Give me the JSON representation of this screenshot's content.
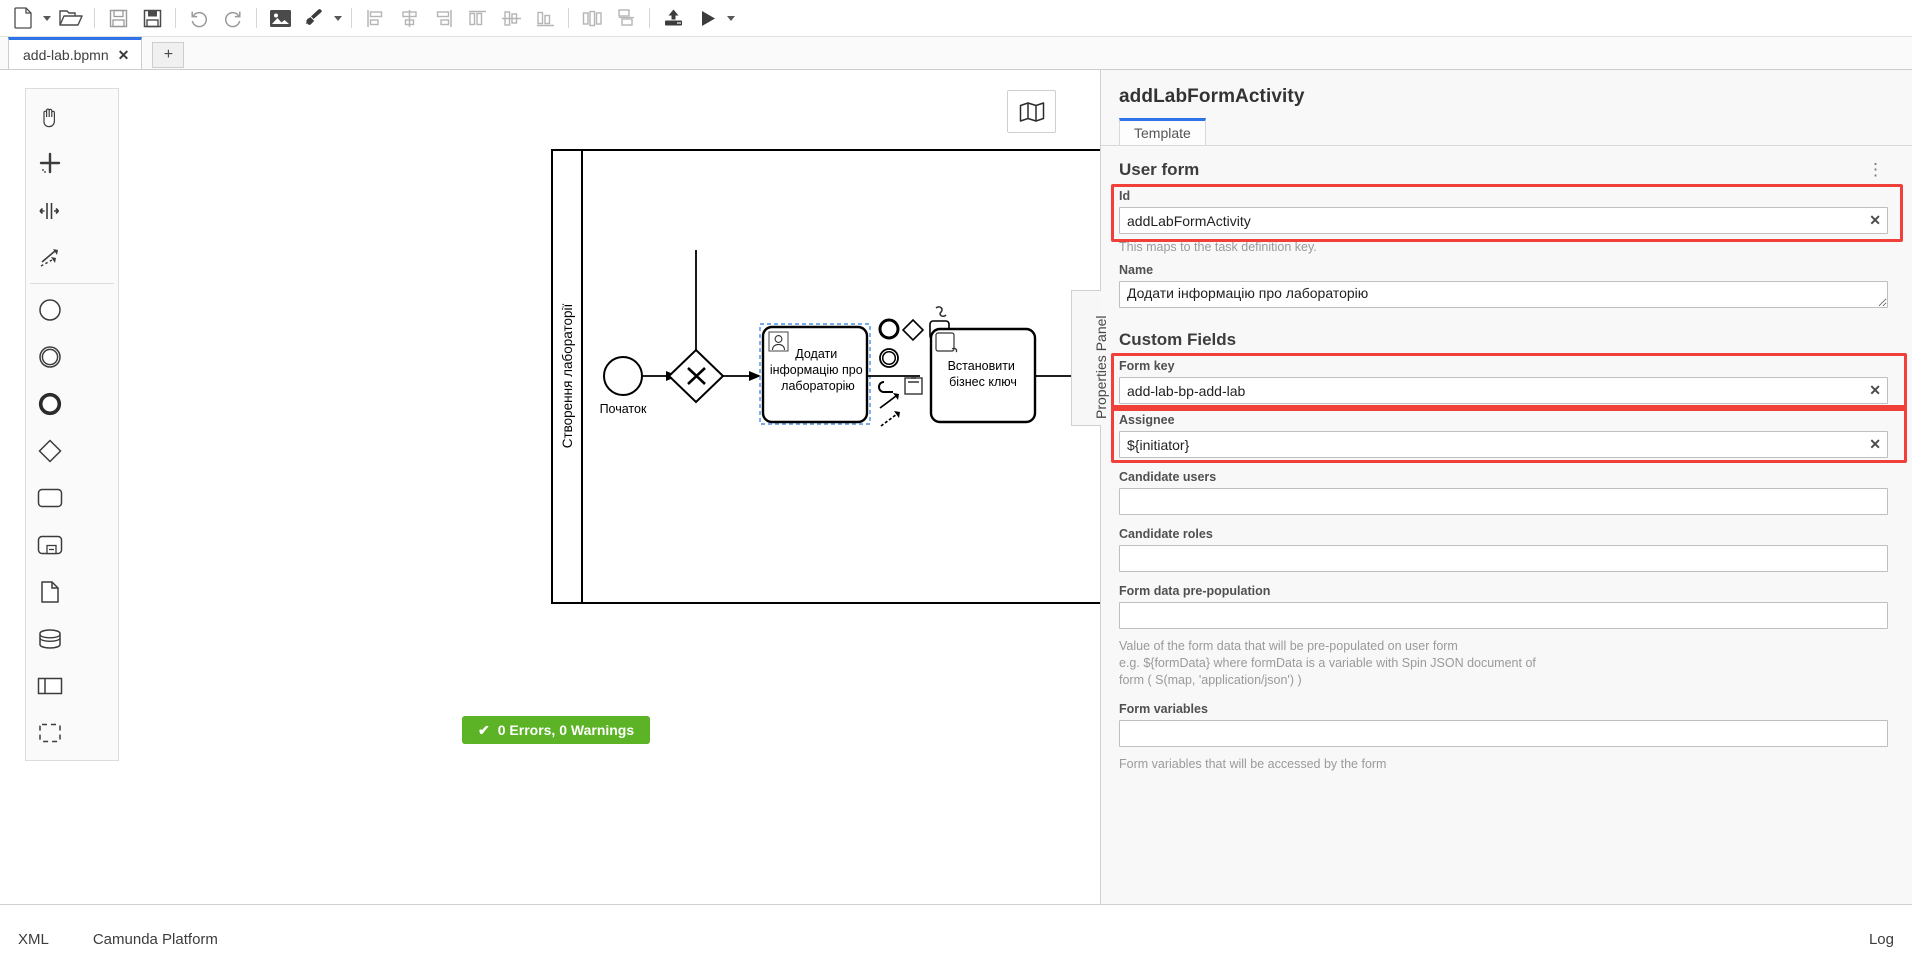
{
  "toolbar": {
    "buttons": [
      {
        "name": "new-file-button",
        "icon": "file-icon",
        "title": "New file"
      },
      {
        "name": "new-file-dropdown",
        "icon": "chevron-down-icon",
        "title": "New file menu"
      },
      {
        "name": "open-file-button",
        "icon": "folder-open-icon",
        "title": "Open file"
      },
      {
        "name": "save-file-button",
        "icon": "save-icon",
        "title": "Save file"
      },
      {
        "name": "save-as-button",
        "icon": "save-as-icon",
        "title": "Save file as"
      },
      {
        "name": "undo-button",
        "icon": "undo-icon",
        "title": "Undo"
      },
      {
        "name": "redo-button",
        "icon": "redo-icon",
        "title": "Redo"
      },
      {
        "name": "export-image-button",
        "icon": "image-icon",
        "title": "Export as image"
      },
      {
        "name": "color-picker-button",
        "icon": "paintbrush-icon",
        "title": "Set color"
      },
      {
        "name": "color-picker-dropdown",
        "icon": "chevron-down-icon",
        "title": "Color menu"
      },
      {
        "name": "align-left-button",
        "icon": "align-left-icon",
        "title": "Align left"
      },
      {
        "name": "align-center-button",
        "icon": "align-center-icon",
        "title": "Align center"
      },
      {
        "name": "align-right-button",
        "icon": "align-right-icon",
        "title": "Align right"
      },
      {
        "name": "align-top-button",
        "icon": "align-top-icon",
        "title": "Align top"
      },
      {
        "name": "align-middle-button",
        "icon": "align-middle-icon",
        "title": "Align middle"
      },
      {
        "name": "align-bottom-button",
        "icon": "align-bottom-icon",
        "title": "Align bottom"
      },
      {
        "name": "distribute-horizontally-button",
        "icon": "distribute-horizontal-icon",
        "title": "Distribute horizontally"
      },
      {
        "name": "distribute-vertically-button",
        "icon": "distribute-vertical-icon",
        "title": "Distribute vertically"
      },
      {
        "name": "deploy-button",
        "icon": "deploy-upload-icon",
        "title": "Deploy current diagram"
      },
      {
        "name": "start-process-button",
        "icon": "play-icon",
        "title": "Start process instance"
      },
      {
        "name": "start-process-dropdown",
        "icon": "chevron-down-icon",
        "title": "Start process menu"
      }
    ]
  },
  "tabs": {
    "open": [
      {
        "label": "add-lab.bpmn",
        "close": "✕"
      }
    ],
    "add_label": "+"
  },
  "palette": {
    "items": [
      {
        "name": "palette-hand-tool",
        "icon": "hand-icon"
      },
      {
        "name": "palette-lasso-tool",
        "icon": "lasso-icon"
      },
      {
        "name": "palette-space-tool",
        "icon": "space-tool-icon"
      },
      {
        "name": "palette-connect-tool",
        "icon": "connect-icon"
      },
      {
        "name": "palette-start-event",
        "icon": "start-event-icon"
      },
      {
        "name": "palette-intermediate-event",
        "icon": "intermediate-event-icon"
      },
      {
        "name": "palette-end-event",
        "icon": "end-event-icon"
      },
      {
        "name": "palette-exclusive-gateway",
        "icon": "gateway-icon"
      },
      {
        "name": "palette-task",
        "icon": "task-icon"
      },
      {
        "name": "palette-subprocess",
        "icon": "subprocess-icon"
      },
      {
        "name": "palette-data-object",
        "icon": "data-object-icon"
      },
      {
        "name": "palette-data-store",
        "icon": "data-store-icon"
      },
      {
        "name": "palette-participant",
        "icon": "participant-icon"
      },
      {
        "name": "palette-group",
        "icon": "group-icon"
      }
    ]
  },
  "canvas": {
    "minimap_title": "Toggle minimap",
    "pool_label": "Створення лабораторії",
    "start_event_label": "Початок",
    "user_task_label": "Додати інформацію про лабораторію",
    "service_task_label": "Встановити бізнес ключ",
    "context_pad": [
      {
        "name": "context-pad-append-end-event",
        "icon": "circle-icon"
      },
      {
        "name": "context-pad-append-gateway",
        "icon": "diamond-icon"
      },
      {
        "name": "context-pad-append-task",
        "icon": "square-icon"
      },
      {
        "name": "context-pad-append-intermediate-event",
        "icon": "circle-outline-icon"
      },
      {
        "name": "context-pad-change-type",
        "icon": "wrench-icon"
      },
      {
        "name": "context-pad-delete",
        "icon": "trash-icon"
      },
      {
        "name": "context-pad-connect",
        "icon": "connect-arrow-icon"
      },
      {
        "name": "context-pad-append-text-annotation",
        "icon": "annotation-icon"
      }
    ],
    "status": {
      "check": "✔",
      "label": "0 Errors, 0 Warnings"
    }
  },
  "properties_handle": {
    "label": "Properties Panel"
  },
  "properties": {
    "title": "addLabFormActivity",
    "tabs": [
      {
        "label": "Template",
        "active": true
      }
    ],
    "sections": [
      {
        "heading": "User form",
        "menu_icon": "kebab-menu-icon"
      },
      {
        "heading": "Custom Fields"
      }
    ],
    "fields": {
      "id": {
        "label": "Id",
        "value": "addLabFormActivity",
        "clear": "✕",
        "hint": "This maps to the task definition key.",
        "highlighted": true
      },
      "name": {
        "label": "Name",
        "value": "Додати інформацію про лабораторію",
        "highlighted": false
      },
      "form_key": {
        "label": "Form key",
        "value": "add-lab-bp-add-lab",
        "clear": "✕",
        "highlighted": true
      },
      "assignee": {
        "label": "Assignee",
        "value": "${initiator}",
        "clear": "✕",
        "highlighted": true
      },
      "candidate_users": {
        "label": "Candidate users",
        "value": "",
        "highlighted": false
      },
      "candidate_roles": {
        "label": "Candidate roles",
        "value": "",
        "highlighted": false
      },
      "form_data_prepopulation": {
        "label": "Form data pre-population",
        "value": "",
        "hint_line1": "Value of the form data that will be pre-populated on user form",
        "hint_line2": "e.g. ${formData} where formData is a variable with Spin JSON document of",
        "hint_line3": "form ( S(map, 'application/json') )",
        "highlighted": false
      },
      "form_variables": {
        "label": "Form variables",
        "value": "",
        "hint": "Form variables that will be accessed by the form",
        "highlighted": false
      }
    }
  },
  "footer": {
    "xml_label": "XML",
    "platform_label": "Camunda Platform",
    "log_label": "Log"
  },
  "colors": {
    "accent_blue": "#2f73e8",
    "highlight_red": "#f1403a",
    "status_green": "#5bb325",
    "panel_bg": "#f8f8f8"
  }
}
